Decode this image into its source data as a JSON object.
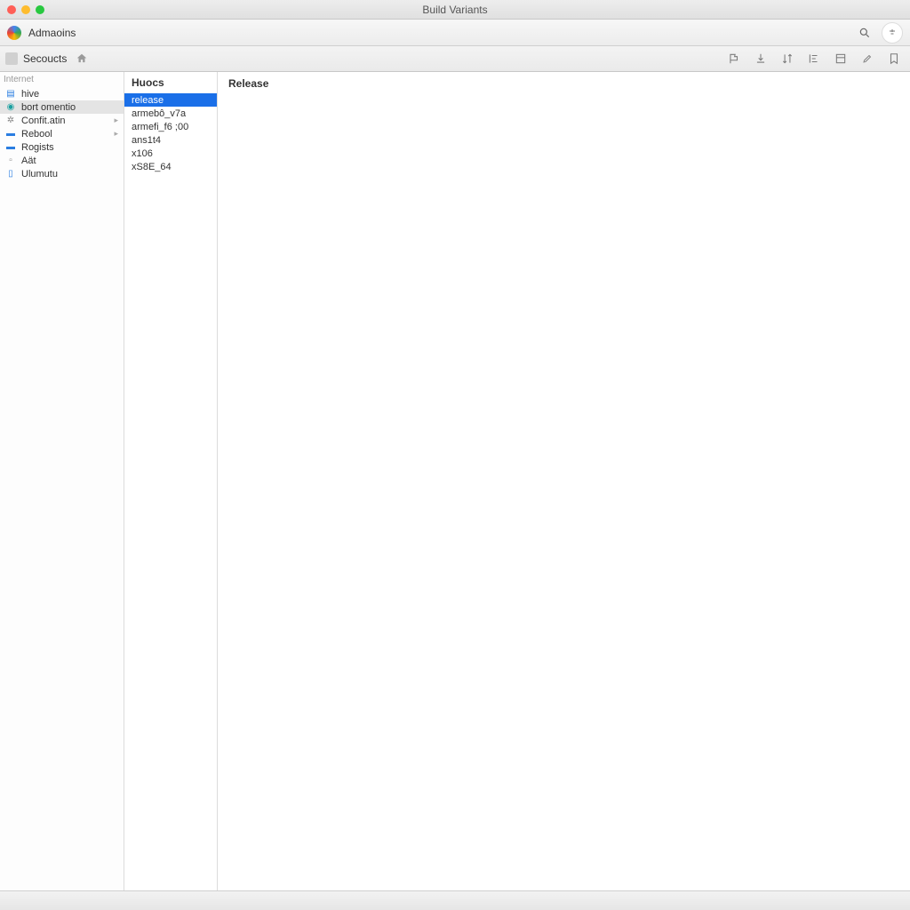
{
  "window": {
    "title": "Build Variants"
  },
  "appbar": {
    "brand": "Admaoins"
  },
  "subbar": {
    "section": "Secoucts"
  },
  "sidebar": {
    "header": "Internet",
    "items": [
      {
        "label": "hive",
        "icon": "doc",
        "color": "blue",
        "selected": false,
        "chevron": false
      },
      {
        "label": "bort omentio",
        "icon": "globe",
        "color": "teal",
        "selected": true,
        "chevron": false
      },
      {
        "label": "Confit.atin",
        "icon": "gear",
        "color": "gray",
        "selected": false,
        "chevron": true
      },
      {
        "label": "Rebool",
        "icon": "folder",
        "color": "blue",
        "selected": false,
        "chevron": true
      },
      {
        "label": "Rogists",
        "icon": "folder",
        "color": "blue",
        "selected": false,
        "chevron": false
      },
      {
        "label": "Aät",
        "icon": "",
        "color": "gray",
        "selected": false,
        "chevron": false
      },
      {
        "label": "Ulumutu",
        "icon": "device",
        "color": "blue",
        "selected": false,
        "chevron": false
      }
    ]
  },
  "variants": {
    "header": "Huocs",
    "items": [
      {
        "label": "release",
        "selected": true
      },
      {
        "label": "armebô_v7a",
        "selected": false
      },
      {
        "label": "armefi_f6 ;00",
        "selected": false
      },
      {
        "label": "ans1t4",
        "selected": false
      },
      {
        "label": "x106",
        "selected": false
      },
      {
        "label": "xS8E_64",
        "selected": false
      }
    ]
  },
  "detail": {
    "header": "Release"
  }
}
